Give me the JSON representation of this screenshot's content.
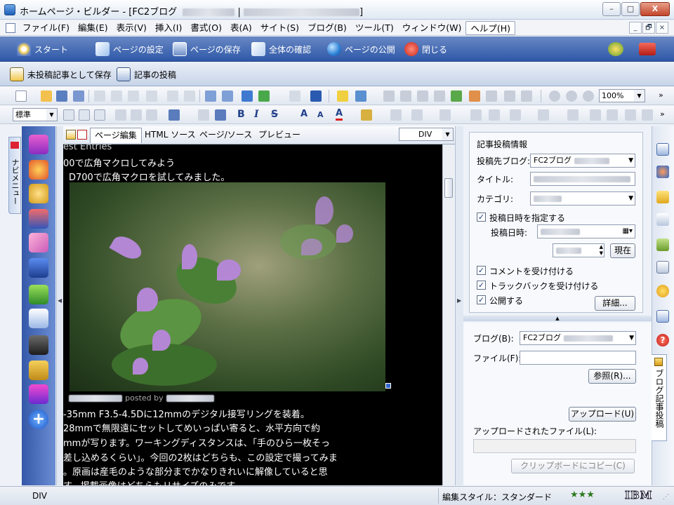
{
  "window": {
    "title_prefix": "ホームページ・ビルダー - [FC2ブログ",
    "title_sep": "|",
    "title_suffix": "]",
    "minimize": "–",
    "maximize": "□",
    "close": "X"
  },
  "menu": [
    "ファイル(F)",
    "編集(E)",
    "表示(V)",
    "挿入(I)",
    "書式(O)",
    "表(A)",
    "サイト(S)",
    "ブログ(B)",
    "ツール(T)",
    "ウィンドウ(W)",
    "ヘルプ(H)"
  ],
  "mdi": {
    "minimize": "_",
    "restore": "🗗",
    "close": "×"
  },
  "bluebar": {
    "start": "スタート",
    "page_settings": "ページの設定",
    "save_page": "ページの保存",
    "check_all": "全体の確認",
    "publish": "ページの公開",
    "close": "閉じる"
  },
  "blogbar": {
    "save_draft": "未投稿記事として保存",
    "post": "記事の投稿"
  },
  "toolbar": {
    "zoom": "100%",
    "style": "標準"
  },
  "nav": {
    "label": "ナビメニュー"
  },
  "editor": {
    "tabs": [
      "ページ編集",
      "HTML ソース",
      "ページ/ソース",
      "プレビュー"
    ],
    "element": "DIV",
    "lines": [
      "est Entries",
      "00で広角マクロしてみよう",
      "D700で広角マクロを試してみました。",
      "-35mm F3.5-4.5Dに12mmのデジタル接写リングを装着。",
      "28mmで無限遠にセットしてめいっぱい寄ると、水平方向で約",
      "mmが写ります。ワーキングディスタンスは、「手のひら一枚そっ",
      "差し込めるくらい」。今回の2枚はどちらも、この設定で撮ってみま",
      "。原画は産毛のような部分までかなりきれいに解像していると思",
      "す。掲載画像はどちらもリサイズのみです。"
    ],
    "posted_by": "posted by"
  },
  "post_info": {
    "group_title": "記事投稿情報",
    "target_blog_label": "投稿先ブログ:",
    "target_blog_value": "FC2ブログ",
    "title_label": "タイトル:",
    "category_label": "カテゴリ:",
    "specify_date": "投稿日時を指定する",
    "date_label": "投稿日時:",
    "now_button": "現在",
    "accept_comments": "コメントを受け付ける",
    "accept_trackbacks": "トラックバックを受け付ける",
    "publish": "公開する",
    "details_button": "詳細..."
  },
  "upload": {
    "blog_label": "ブログ(B):",
    "blog_value": "FC2ブログ",
    "file_label": "ファイル(F):",
    "browse_button": "参照(R)...",
    "upload_button": "アップロード(U)",
    "uploaded_label": "アップロードされたファイル(L):",
    "copy_button": "クリップボードにコピー(C)"
  },
  "right_tab": "ブログ記事投稿",
  "status": {
    "left": "DIV",
    "style": "編集スタイル：スタンダード",
    "brand": "IBM"
  }
}
